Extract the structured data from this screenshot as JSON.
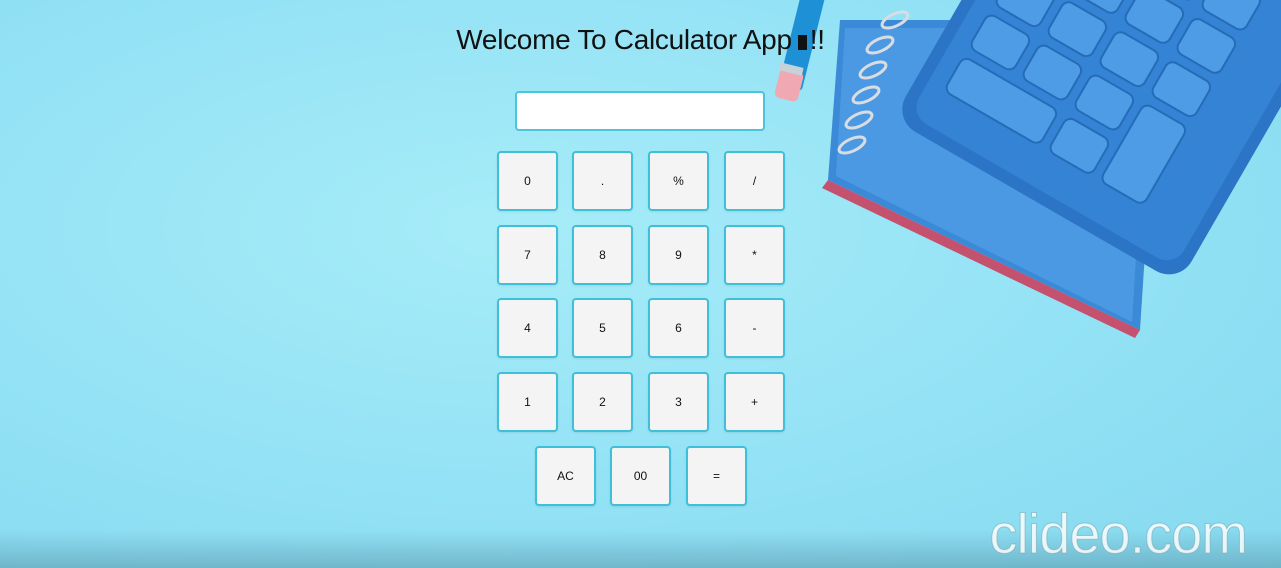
{
  "app": {
    "title": "Welcome To Calculator App",
    "title_suffix": "!!"
  },
  "display": {
    "value": ""
  },
  "keypad": {
    "row1": [
      "0",
      ".",
      "%",
      "/"
    ],
    "row2": [
      "7",
      "8",
      "9",
      "*"
    ],
    "row3": [
      "4",
      "5",
      "6",
      "-"
    ],
    "row4": [
      "1",
      "2",
      "3",
      "+"
    ],
    "row5": [
      "AC",
      "00",
      "="
    ]
  },
  "watermark": "clideo.com",
  "colors": {
    "background": "#93e2f5",
    "key_border": "#3fbfd8",
    "key_fill": "#f4f4f4",
    "decor_calculator": "#2b74c6"
  }
}
